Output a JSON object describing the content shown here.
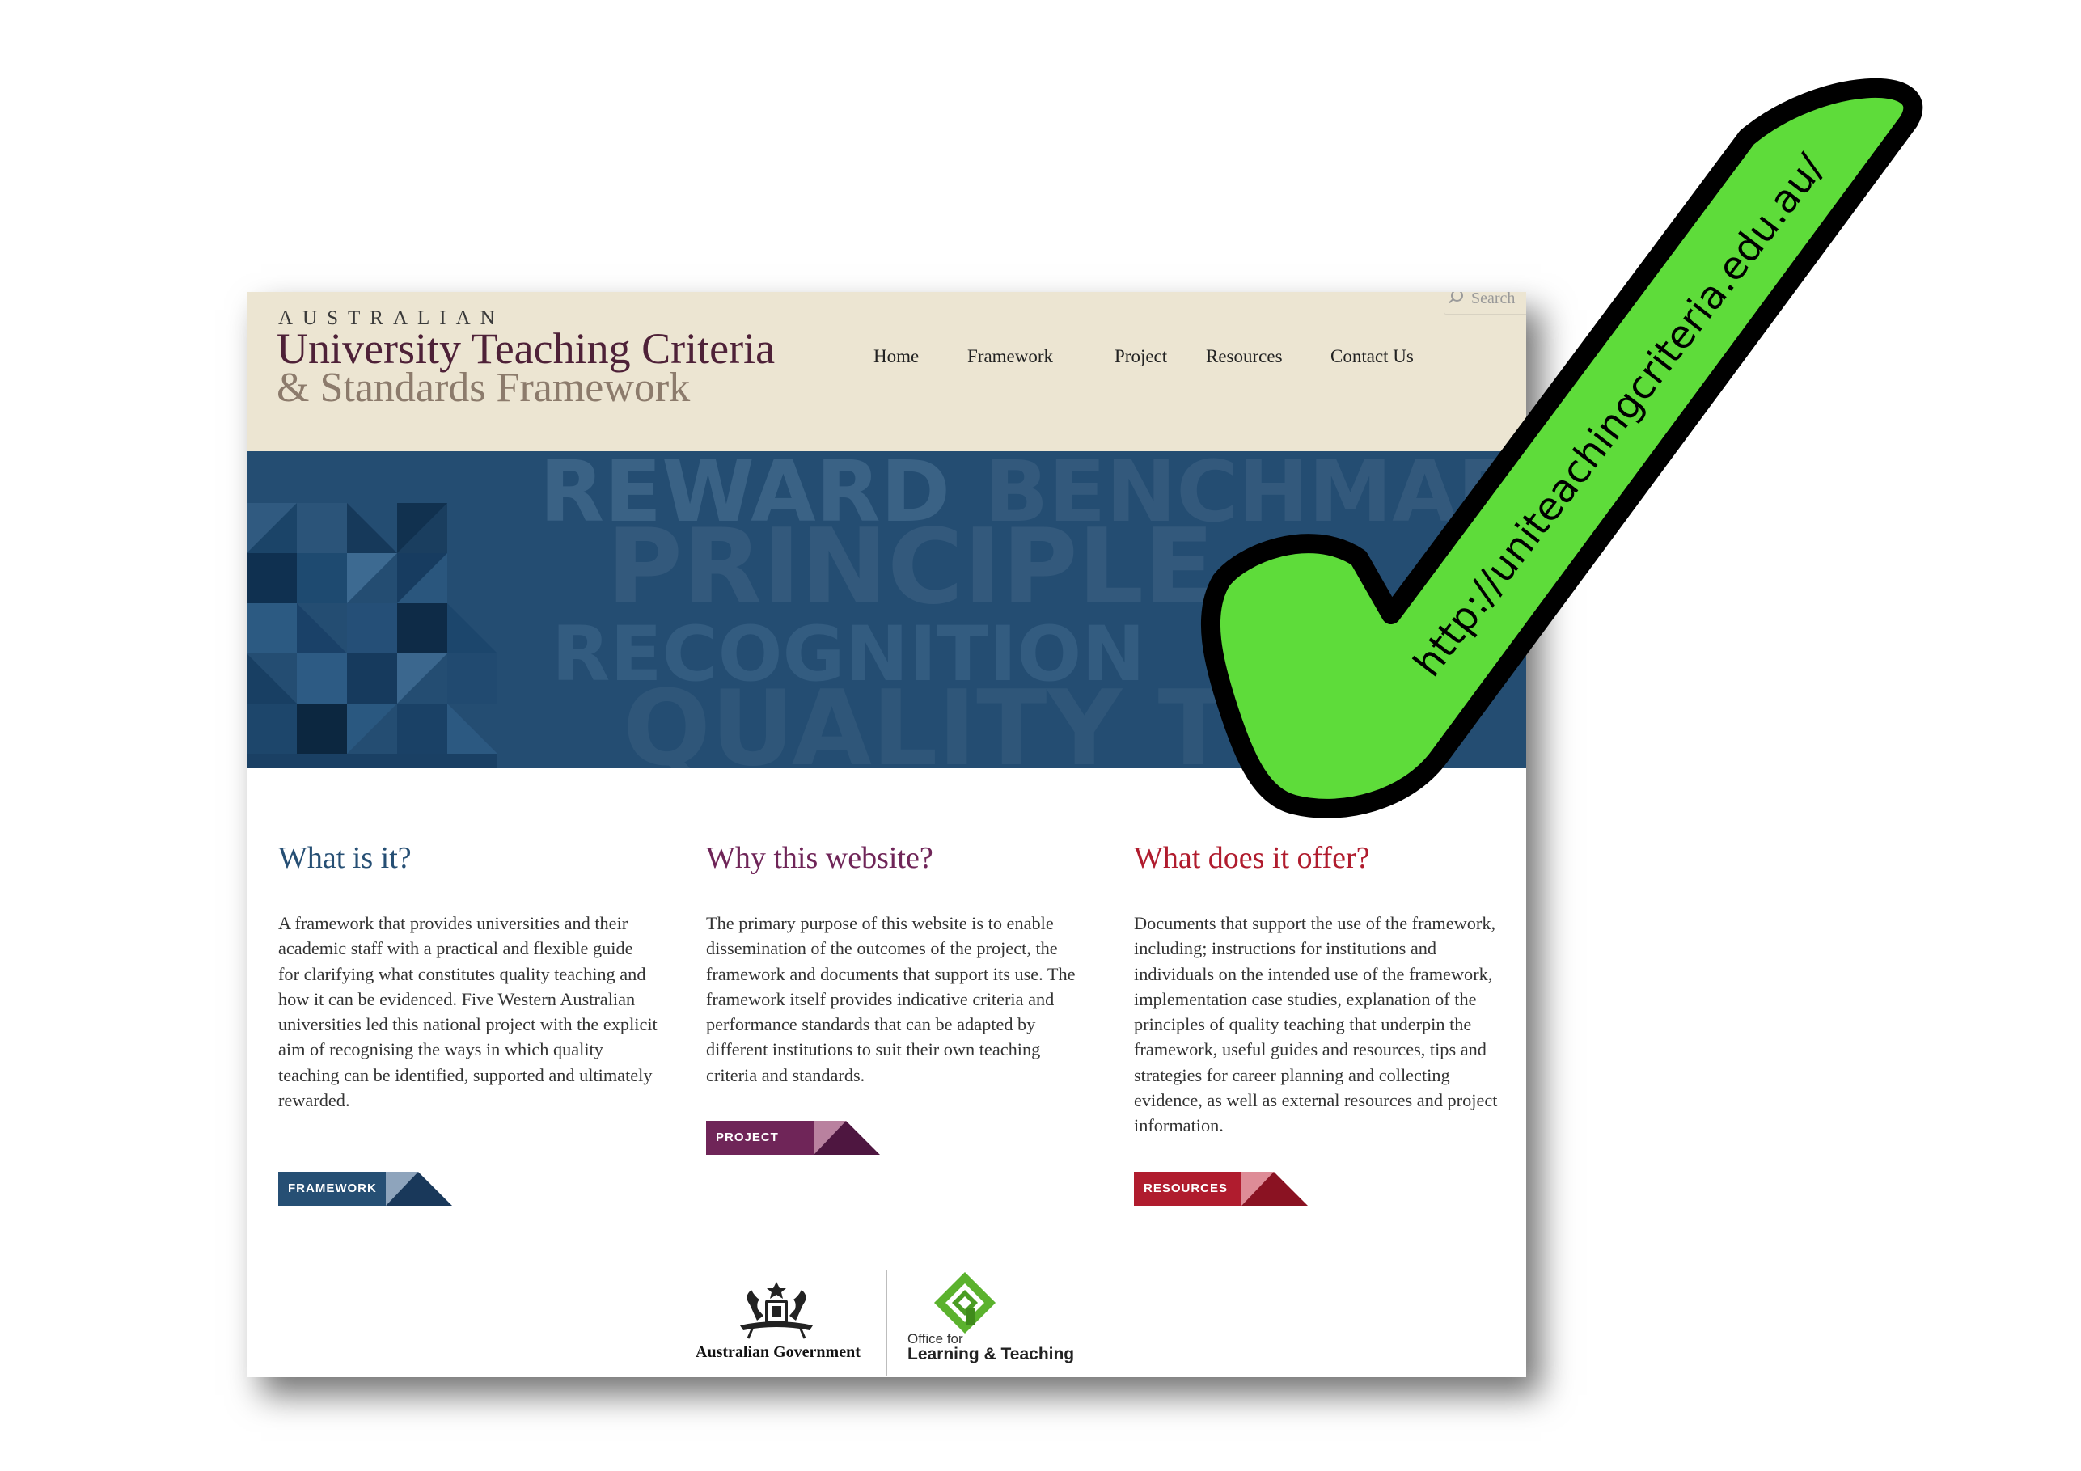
{
  "site": {
    "logo_small": "AUSTRALIAN",
    "logo_line1": "University Teaching Criteria",
    "logo_line2": "& Standards Framework",
    "search_placeholder": "Search"
  },
  "nav": [
    "Home",
    "Framework",
    "Project",
    "Resources",
    "Contact Us"
  ],
  "banner_words": [
    "REWARD",
    "BENCHMAR",
    "PRINCIPLE",
    "RECOGNITION",
    "QUALITY T"
  ],
  "columns": [
    {
      "title": "What is it?",
      "text": "A framework that provides universities and their academic staff with a practical and flexible guide for clarifying what constitutes quality teaching and how it can be evidenced. Five Western Australian universities led this national project with the explicit aim of recognising the ways in which quality teaching can be identified, supported and ultimately rewarded.",
      "button": "FRAMEWORK",
      "color": "#264f74"
    },
    {
      "title": "Why this website?",
      "text": "The primary purpose of this website is to enable dissemination of the outcomes of the project, the framework and documents that support its use. The framework itself provides indicative criteria and performance standards that can be adapted by different institutions to suit their own teaching criteria and standards.",
      "button": "PROJECT",
      "color": "#6f2558"
    },
    {
      "title": "What does it offer?",
      "text": "Documents that support the use of the framework, including; instructions for institutions and individuals on the intended use of the framework, implementation case studies, explanation of the principles of quality teaching that underpin the framework, useful guides and resources, tips and strategies for career planning and collecting evidence, as well as external resources and project information.",
      "button": "RESOURCES",
      "color": "#b01c2e"
    }
  ],
  "footer": {
    "gov_label": "Australian Government",
    "olt_small": "Office for",
    "olt_big": "Learning & Teaching"
  },
  "overlay": {
    "url": "http://uniteachingcriteria.edu.au/",
    "check_color": "#5edc3a"
  },
  "icons": [
    "search-icon",
    "coat-of-arms-icon",
    "olt-logo-icon",
    "checkmark-icon"
  ]
}
